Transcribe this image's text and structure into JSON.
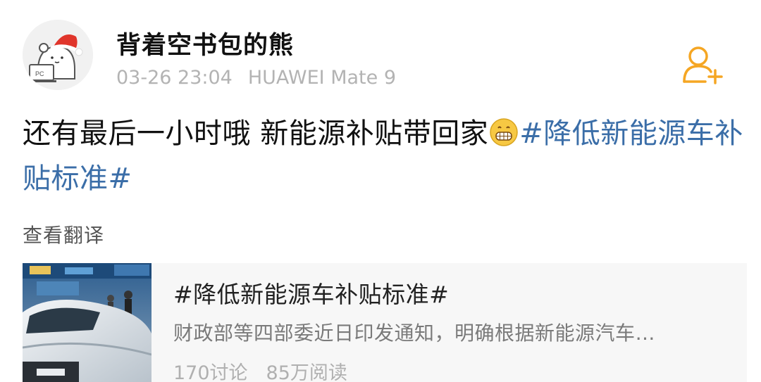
{
  "user": {
    "name": "背着空书包的熊",
    "time": "03-26 23:04",
    "device": "HUAWEI Mate 9",
    "avatar_icon": "bear-santa-hat-laptop-avatar",
    "avatar_laptop_text": "PC"
  },
  "follow_button": {
    "icon": "add-user-icon",
    "color": "#f5a623"
  },
  "post": {
    "text": "还有最后一小时哦 新能源补贴带回家",
    "emoji": "grinning-emoji",
    "topic": "#降低新能源车补贴标准#",
    "topic_color": "#3b6ea8"
  },
  "translate_label": "查看翻译",
  "card": {
    "thumbnail": "car-show-photo",
    "title": "#降低新能源车补贴标准#",
    "description": "财政部等四部委近日印发通知，明确根据新能源汽车…",
    "stats": {
      "discussions": "170讨论",
      "reads": "85万阅读"
    }
  }
}
